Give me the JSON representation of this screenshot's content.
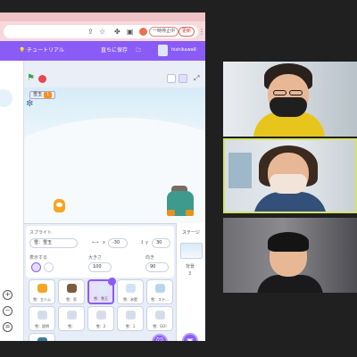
{
  "browser": {
    "profile_status": "一時停止中",
    "update_label": "更新"
  },
  "scratch_menu": {
    "tutorials": "チュートリアル",
    "save_now": "直ちに保存",
    "username": "hishikawa6"
  },
  "stage": {
    "variable_monitor": {
      "name": "雪玉",
      "value": "1"
    }
  },
  "sprite_info": {
    "sprite_label": "スプライト",
    "sprite_name": "雪：雪玉",
    "x_label": "x",
    "x_value": "-30",
    "y_label": "y",
    "y_value": "30",
    "show_label": "表示する",
    "size_label": "大きさ",
    "size_value": "100",
    "direction_label": "向き",
    "direction_value": "90"
  },
  "sprites": [
    {
      "name": "雪：主人公",
      "color": "#f6a623"
    },
    {
      "name": "雪：家",
      "color": "#7a5c3e"
    },
    {
      "name": "雪：雪玉",
      "color": "#dfe9f5",
      "selected": true
    },
    {
      "name": "雪：氷壁",
      "color": "#cfe3f3"
    },
    {
      "name": "雪：ステ…",
      "color": "#b7d5ee"
    },
    {
      "name": "雪：説明",
      "color": "#d6ddea"
    },
    {
      "name": "雪：",
      "color": "#d6ddea"
    },
    {
      "name": "雪：2",
      "color": "#d6ddea"
    },
    {
      "name": "雪：1",
      "color": "#d6ddea"
    },
    {
      "name": "雪：GO!",
      "color": "#d6ddea"
    },
    {
      "name": "雪：ボイ…",
      "color": "#3e7b9a"
    }
  ],
  "stage_panel": {
    "title": "ステージ",
    "backdrops_label": "背景",
    "backdrops_count": "3"
  },
  "colors": {
    "scratch_purple": "#8a5cf5",
    "active_speaker_border": "#d4e36a"
  }
}
